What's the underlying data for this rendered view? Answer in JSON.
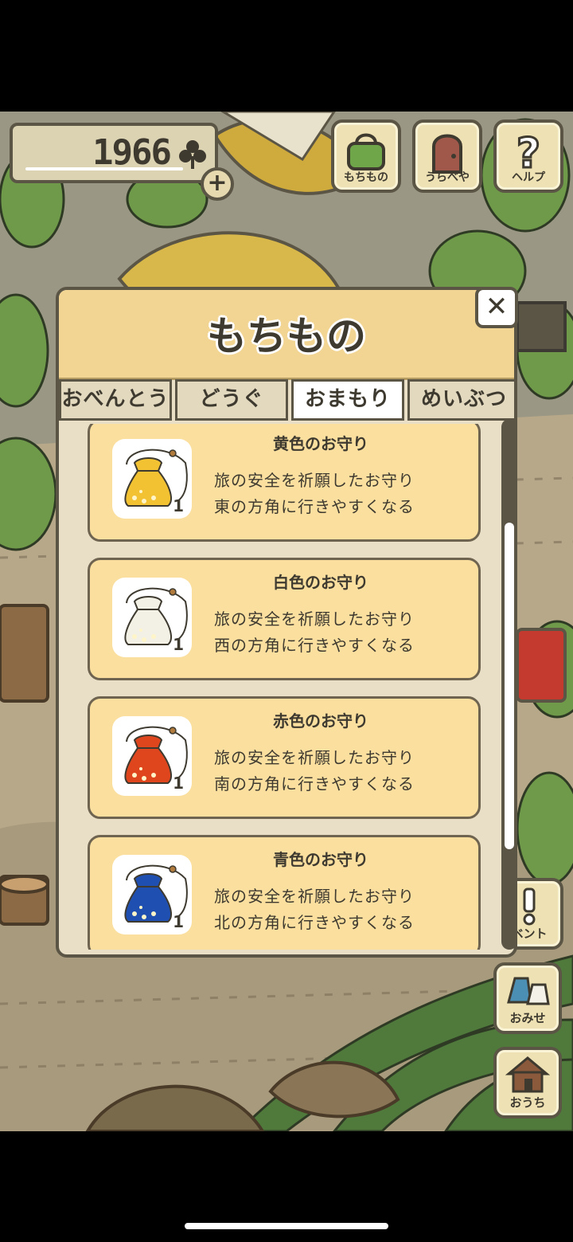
{
  "header": {
    "clover_count": "1966",
    "add_label": "+",
    "buttons": [
      {
        "label": "もちもの",
        "icon": "bag-icon"
      },
      {
        "label": "うらべや",
        "icon": "door-icon"
      },
      {
        "label": "ヘルプ",
        "icon": "question-icon"
      }
    ]
  },
  "modal": {
    "title": "もちもの",
    "close_label": "✕",
    "tabs": [
      {
        "label": "おべんとう",
        "active": false
      },
      {
        "label": "どうぐ",
        "active": false
      },
      {
        "label": "おまもり",
        "active": true
      },
      {
        "label": "めいぶつ",
        "active": false
      }
    ],
    "items": [
      {
        "name": "黄色のお守り",
        "line1": "旅の安全を祈願したお守り",
        "line2": "東の方角に行きやすくなる",
        "qty": "1",
        "color": "#f2c233",
        "icon": "yellow-charm-icon"
      },
      {
        "name": "白色のお守り",
        "line1": "旅の安全を祈願したお守り",
        "line2": "西の方角に行きやすくなる",
        "qty": "1",
        "color": "#f3f0e6",
        "icon": "white-charm-icon"
      },
      {
        "name": "赤色のお守り",
        "line1": "旅の安全を祈願したお守り",
        "line2": "南の方角に行きやすくなる",
        "qty": "1",
        "color": "#e0461e",
        "icon": "red-charm-icon"
      },
      {
        "name": "青色のお守り",
        "line1": "旅の安全を祈願したお守り",
        "line2": "北の方角に行きやすくなる",
        "qty": "1",
        "color": "#1f4fb0",
        "icon": "blue-charm-icon"
      }
    ]
  },
  "side": {
    "buttons": [
      {
        "label": "ベント",
        "icon": "exclamation-icon"
      },
      {
        "label": "おみせ",
        "icon": "shop-bags-icon"
      },
      {
        "label": "おうち",
        "icon": "house-icon"
      }
    ]
  }
}
